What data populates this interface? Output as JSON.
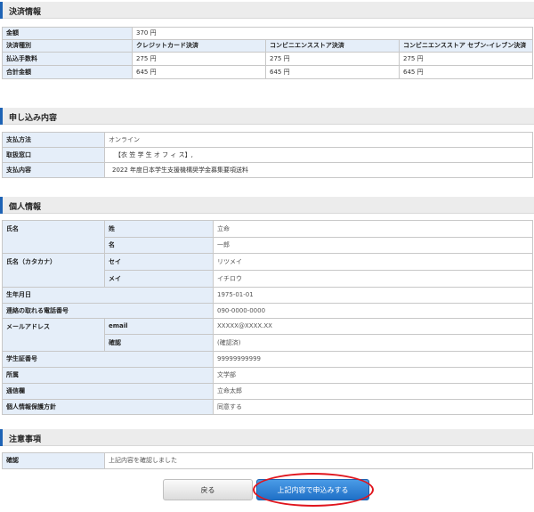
{
  "sections": {
    "payment": "決済情報",
    "application": "申し込み内容",
    "personal": "個人情報",
    "notes": "注意事項"
  },
  "payment": {
    "amount_label": "金額",
    "amount_value": "370 円",
    "type_label": "決済種別",
    "types": [
      "クレジットカード決済",
      "コンビニエンスストア決済",
      "コンビニエンスストア セブン-イレブン決済"
    ],
    "fee_label": "払込手数料",
    "fees": [
      "275 円",
      "275 円",
      "275 円"
    ],
    "total_label": "合計金額",
    "totals": [
      "645 円",
      "645 円",
      "645 円"
    ]
  },
  "application": {
    "method_label": "支払方法",
    "method_value": "オンライン",
    "office_label": "取扱窓口",
    "office_value": "【衣 笠 学 生 オ フ ィ ス】,",
    "content_label": "支払内容",
    "content_value": "2022 年度日本学生支援機構奨学金募集要項送料"
  },
  "personal": {
    "name_label": "氏名",
    "sei_label": "姓",
    "sei_value": "立命",
    "mei_label": "名",
    "mei_value": "一郎",
    "kana_label": "氏名（カタカナ）",
    "kana_sei_label": "セイ",
    "kana_sei_value": "リツメイ",
    "kana_mei_label": "メイ",
    "kana_mei_value": "イチロウ",
    "birth_label": "生年月日",
    "birth_value": "1975-01-01",
    "phone_label": "連絡の取れる電話番号",
    "phone_value": "090-0000-0000",
    "email_label": "メールアドレス",
    "email_sub": "email",
    "email_value": "XXXXX@XXXX.XX",
    "confirm_sub": "確認",
    "confirm_value": "(確認済)",
    "student_label": "学生証番号",
    "student_value": "99999999999",
    "dept_label": "所属",
    "dept_value": "文学部",
    "comm_label": "通信欄",
    "comm_value": "立命太郎",
    "privacy_label": "個人情報保護方針",
    "privacy_value": "同意する"
  },
  "notes": {
    "confirm_label": "確認",
    "confirm_value": "上記内容を確認しました"
  },
  "buttons": {
    "back": "戻る",
    "submit": "上記内容で申込みする"
  },
  "colors": {
    "accent": "#1e63b5",
    "label_bg": "#e5eef9",
    "highlight_ring": "#e0151d"
  }
}
